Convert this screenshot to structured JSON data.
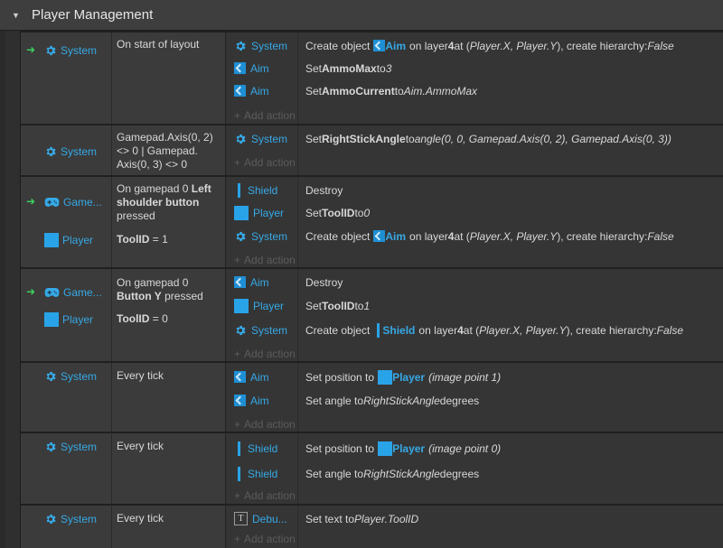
{
  "group": {
    "title": "Player Management"
  },
  "labels": {
    "system": "System",
    "aim": "Aim",
    "player": "Player",
    "shield": "Shield",
    "gamepad": "Game...",
    "debug": "Debu...",
    "add_action": "Add action"
  },
  "events": [
    {
      "conditions": [
        {
          "object": "System",
          "text": "On start of layout"
        }
      ],
      "actions": [
        {
          "object": "System",
          "parts": [
            "Create object ",
            "Aim",
            " on layer ",
            "4",
            " at (",
            "Player.X, Player.Y",
            "), create hierarchy: ",
            "False"
          ]
        },
        {
          "object": "Aim",
          "parts": [
            "Set ",
            "AmmoMax",
            " to ",
            "3"
          ]
        },
        {
          "object": "Aim",
          "parts": [
            "Set ",
            "AmmoCurrent",
            " to ",
            "Aim.AmmoMax"
          ]
        }
      ]
    },
    {
      "conditions": [
        {
          "object": "System",
          "text": "Gamepad.Axis(0, 2) <> 0 | Gamepad. Axis(0, 3) <> 0"
        }
      ],
      "actions": [
        {
          "object": "System",
          "parts": [
            "Set ",
            "RightStickAngle",
            " to ",
            "angle(0, 0, Gamepad.Axis(0, 2), Gamepad.Axis(0, 3))"
          ]
        }
      ]
    },
    {
      "conditions": [
        {
          "object": "Game...",
          "text_pre": "On gamepad 0 ",
          "text_bold": "Left shoulder button",
          "text_post": " pressed"
        },
        {
          "object": "Player",
          "text_bold": "ToolID",
          "text_post": " = 1"
        }
      ],
      "actions": [
        {
          "object": "Shield",
          "parts": [
            "Destroy"
          ]
        },
        {
          "object": "Player",
          "parts": [
            "Set ",
            "ToolID",
            " to ",
            "0"
          ]
        },
        {
          "object": "System",
          "parts": [
            "Create object ",
            "Aim",
            " on layer ",
            "4",
            " at (",
            "Player.X, Player.Y",
            "), create hierarchy: ",
            "False"
          ]
        }
      ]
    },
    {
      "conditions": [
        {
          "object": "Game...",
          "text_pre": "On gamepad 0 ",
          "text_bold": "Button Y",
          "text_post": " pressed"
        },
        {
          "object": "Player",
          "text_bold": "ToolID",
          "text_post": " = 0"
        }
      ],
      "actions": [
        {
          "object": "Aim",
          "parts": [
            "Destroy"
          ]
        },
        {
          "object": "Player",
          "parts": [
            "Set ",
            "ToolID",
            " to ",
            "1"
          ]
        },
        {
          "object": "System",
          "parts": [
            "Create object ",
            "Shield",
            " on layer ",
            "4",
            " at (",
            "Player.X, Player.Y",
            "), create hierarchy: ",
            "False"
          ]
        }
      ]
    },
    {
      "conditions": [
        {
          "object": "System",
          "text": "Every tick"
        }
      ],
      "actions": [
        {
          "object": "Aim",
          "parts": [
            "Set position to ",
            "Player",
            " ",
            "(image point 1)"
          ]
        },
        {
          "object": "Aim",
          "parts": [
            "Set angle to ",
            "RightStickAngle",
            " degrees"
          ]
        }
      ]
    },
    {
      "conditions": [
        {
          "object": "System",
          "text": "Every tick"
        }
      ],
      "actions": [
        {
          "object": "Shield",
          "parts": [
            "Set position to ",
            "Player",
            " ",
            "(image point 0)"
          ]
        },
        {
          "object": "Shield",
          "parts": [
            "Set angle to ",
            "RightStickAngle",
            " degrees"
          ]
        }
      ]
    },
    {
      "conditions": [
        {
          "object": "System",
          "text": "Every tick"
        }
      ],
      "actions": [
        {
          "object": "Debu...",
          "parts": [
            "Set text to ",
            "Player.ToolID"
          ]
        }
      ]
    }
  ],
  "colors": {
    "object_blue": "#36a9e6",
    "trigger_green": "#3ecf5c",
    "background": "#2a2a2a"
  }
}
